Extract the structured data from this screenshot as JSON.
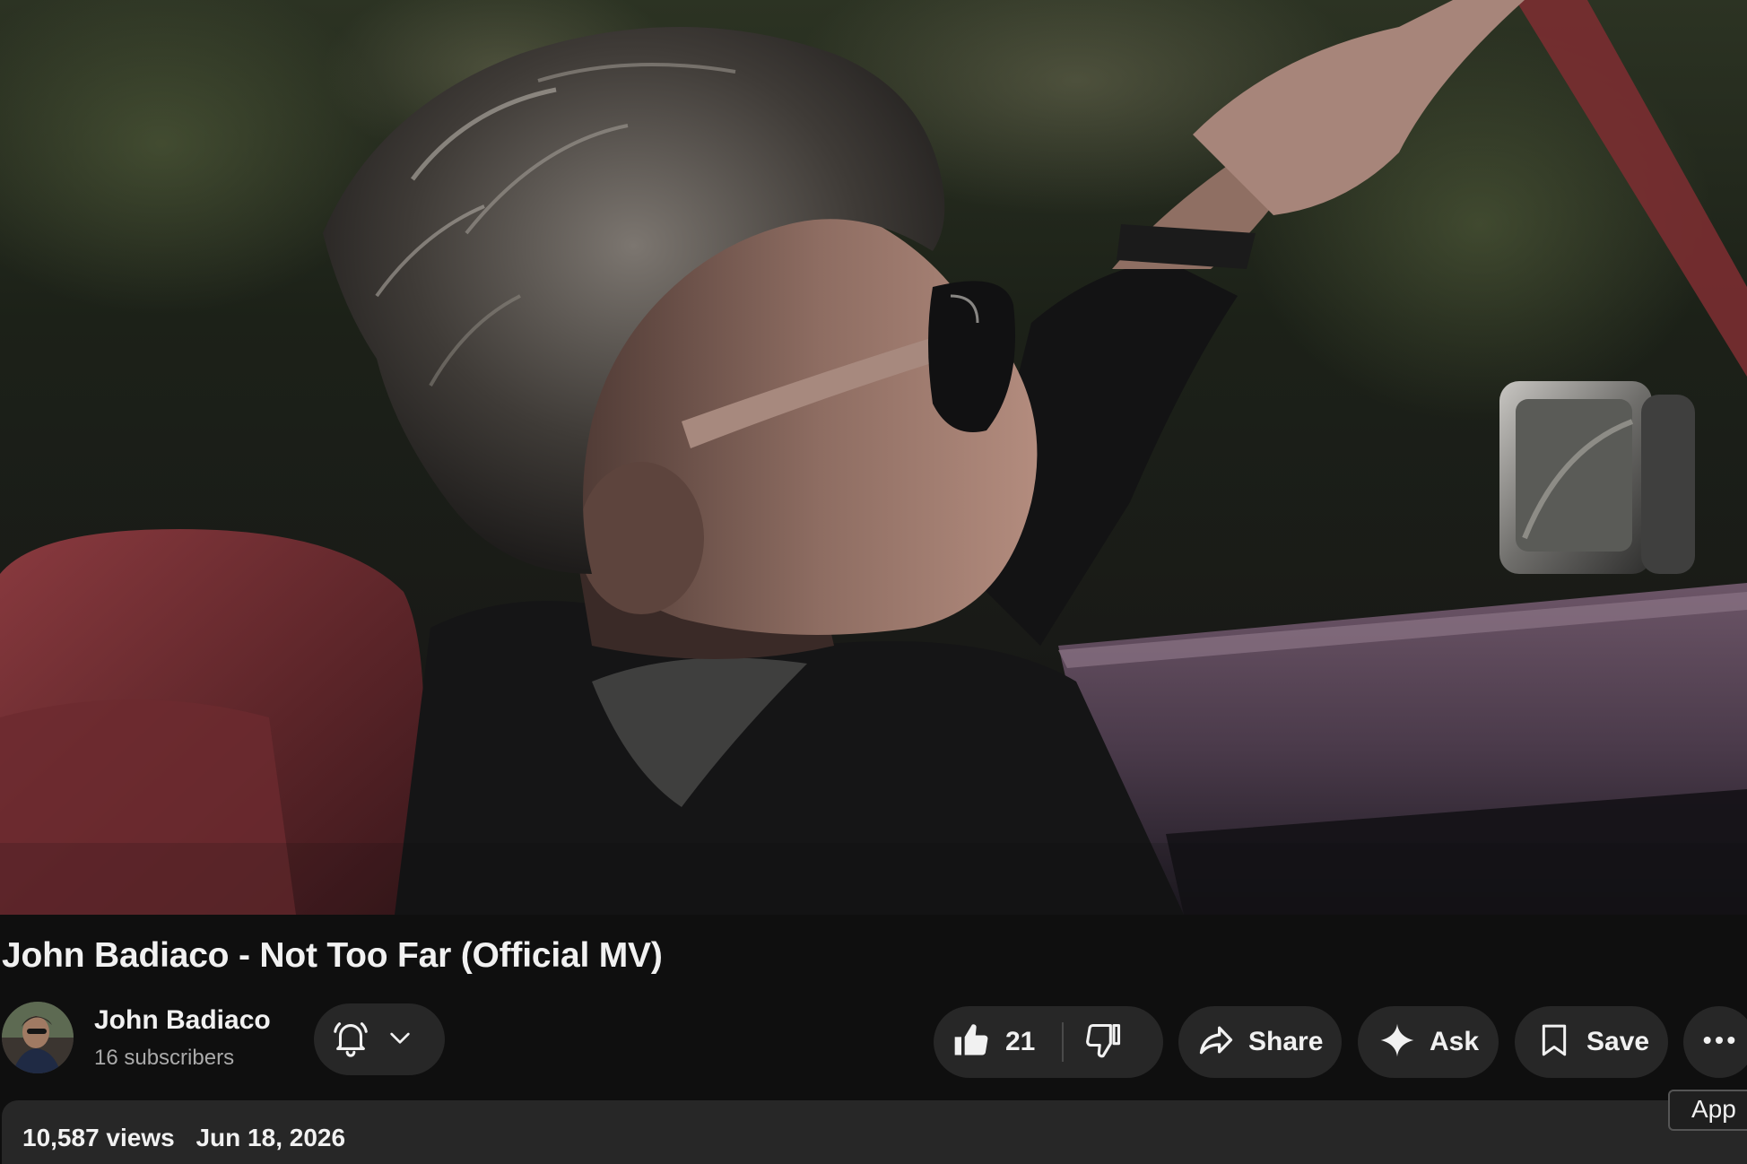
{
  "video": {
    "title": "John Badiaco - Not Too Far (Official MV)"
  },
  "channel": {
    "name": "John Badiaco",
    "subscribers": "16 subscribers"
  },
  "actions": {
    "like_count": "21",
    "share_label": "Share",
    "ask_label": "Ask",
    "save_label": "Save"
  },
  "tooltip": {
    "text": "App"
  },
  "description": {
    "views": "10,587 views",
    "date": "Jun 18, 2026"
  },
  "icons": {
    "notifications": "bell-icon",
    "notify_menu": "chevron-down-icon",
    "like": "thumbs-up-icon",
    "dislike": "thumbs-down-icon",
    "share": "share-arrow-icon",
    "ask": "sparkle-icon",
    "save": "bookmark-icon",
    "more": "more-horizontal-icon"
  },
  "colors": {
    "background": "#0f0f0f",
    "pill": "#272727",
    "text_primary": "#f1f1f1",
    "text_secondary": "#aaaaaa"
  }
}
